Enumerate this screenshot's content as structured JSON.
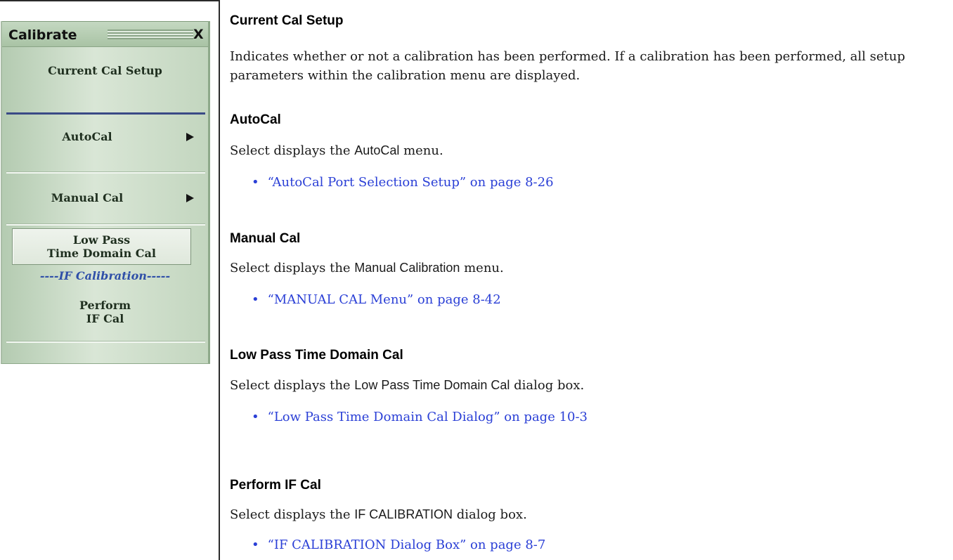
{
  "menu": {
    "title": "Calibrate",
    "close": "X",
    "items": {
      "current_cal_setup": "Current Cal Setup",
      "autocal": "AutoCal",
      "manual_cal": "Manual Cal",
      "low_pass_line1": "Low Pass",
      "low_pass_line2": "Time Domain Cal",
      "if_section_label": "----IF Calibration-----",
      "perform_line1": "Perform",
      "perform_line2": "IF Cal"
    }
  },
  "doc": {
    "sections": [
      {
        "heading": "Current Cal Setup",
        "body": "Indicates whether or not a calibration has been performed. If a calibration has been performed, all setup parameters within the calibration menu are displayed."
      },
      {
        "heading": "AutoCal",
        "body_prefix": "Select displays the ",
        "body_ui": "AutoCal",
        "body_suffix": " menu.",
        "link": "“AutoCal Port Selection Setup” on page 8-26"
      },
      {
        "heading": "Manual Cal",
        "body_prefix": "Select displays the ",
        "body_ui": "Manual Calibration",
        "body_suffix": " menu.",
        "link": "“MANUAL CAL Menu” on page 8-42"
      },
      {
        "heading": "Low Pass Time Domain Cal",
        "body_prefix": "Select displays the ",
        "body_ui": "Low Pass Time Domain Cal",
        "body_suffix": " dialog box.",
        "link": "“Low Pass Time Domain Cal Dialog” on page 10-3"
      },
      {
        "heading": "Perform IF Cal",
        "body_prefix": "Select displays the ",
        "body_ui": "IF CALIBRATION",
        "body_suffix": " dialog box.",
        "link": "“IF CALIBRATION Dialog Box” on page 8-7"
      }
    ],
    "bullet_char": "•"
  }
}
